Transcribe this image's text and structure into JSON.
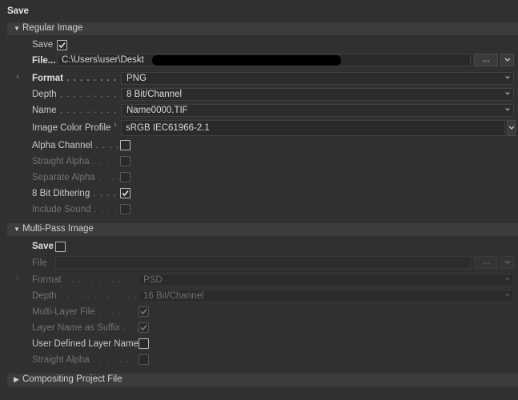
{
  "title": "Save",
  "regular": {
    "header": "Regular Image",
    "save_label": "Save",
    "file_label": "File...",
    "file_value": "C:\\Users\\user\\Deskt",
    "browse_label": "...",
    "format_label": "Format",
    "format_value": "PNG",
    "depth_label": "Depth",
    "depth_value": "8 Bit/Channel",
    "name_label": "Name",
    "name_value": "Name0000.TIF",
    "profile_label": "Image Color Profile",
    "profile_value": "sRGB IEC61966-2.1",
    "alpha_label": "Alpha Channel",
    "straight_alpha_label": "Straight Alpha",
    "separate_alpha_label": "Separate Alpha",
    "dithering_label": "8 Bit Dithering",
    "sound_label": "Include Sound"
  },
  "multipass": {
    "header": "Multi-Pass Image",
    "save_label": "Save",
    "file_label": "File",
    "browse_label": "...",
    "format_label": "Format",
    "format_value": "PSD",
    "depth_label": "Depth",
    "depth_value": "16 Bit/Channel",
    "multilayer_label": "Multi-Layer File",
    "layer_suffix_label": "Layer Name as Suffix",
    "user_layer_label": "User Defined Layer Name",
    "straight_alpha_label": "Straight Alpha"
  },
  "compositing": {
    "header": "Compositing Project File"
  },
  "dots": {
    "format": " . . . . . . . . . . .",
    "depth": " . . . . . . . . . . . .",
    "name": " . . . . . . . . . . . .",
    "alpha": " . . . . .",
    "straight": " . . . . .",
    "separate": " . . . .",
    "dither": " . . . . .",
    "sound": " . . . . .",
    "mp_format": " . . . . . . . . . . . . . .",
    "mp_depth": " . . . . . . . . . . . . . . .",
    "mp_multilayer": " . . . . . . . .",
    "mp_suffix": " . . .",
    "mp_straight": " . . . . . . . . ."
  }
}
